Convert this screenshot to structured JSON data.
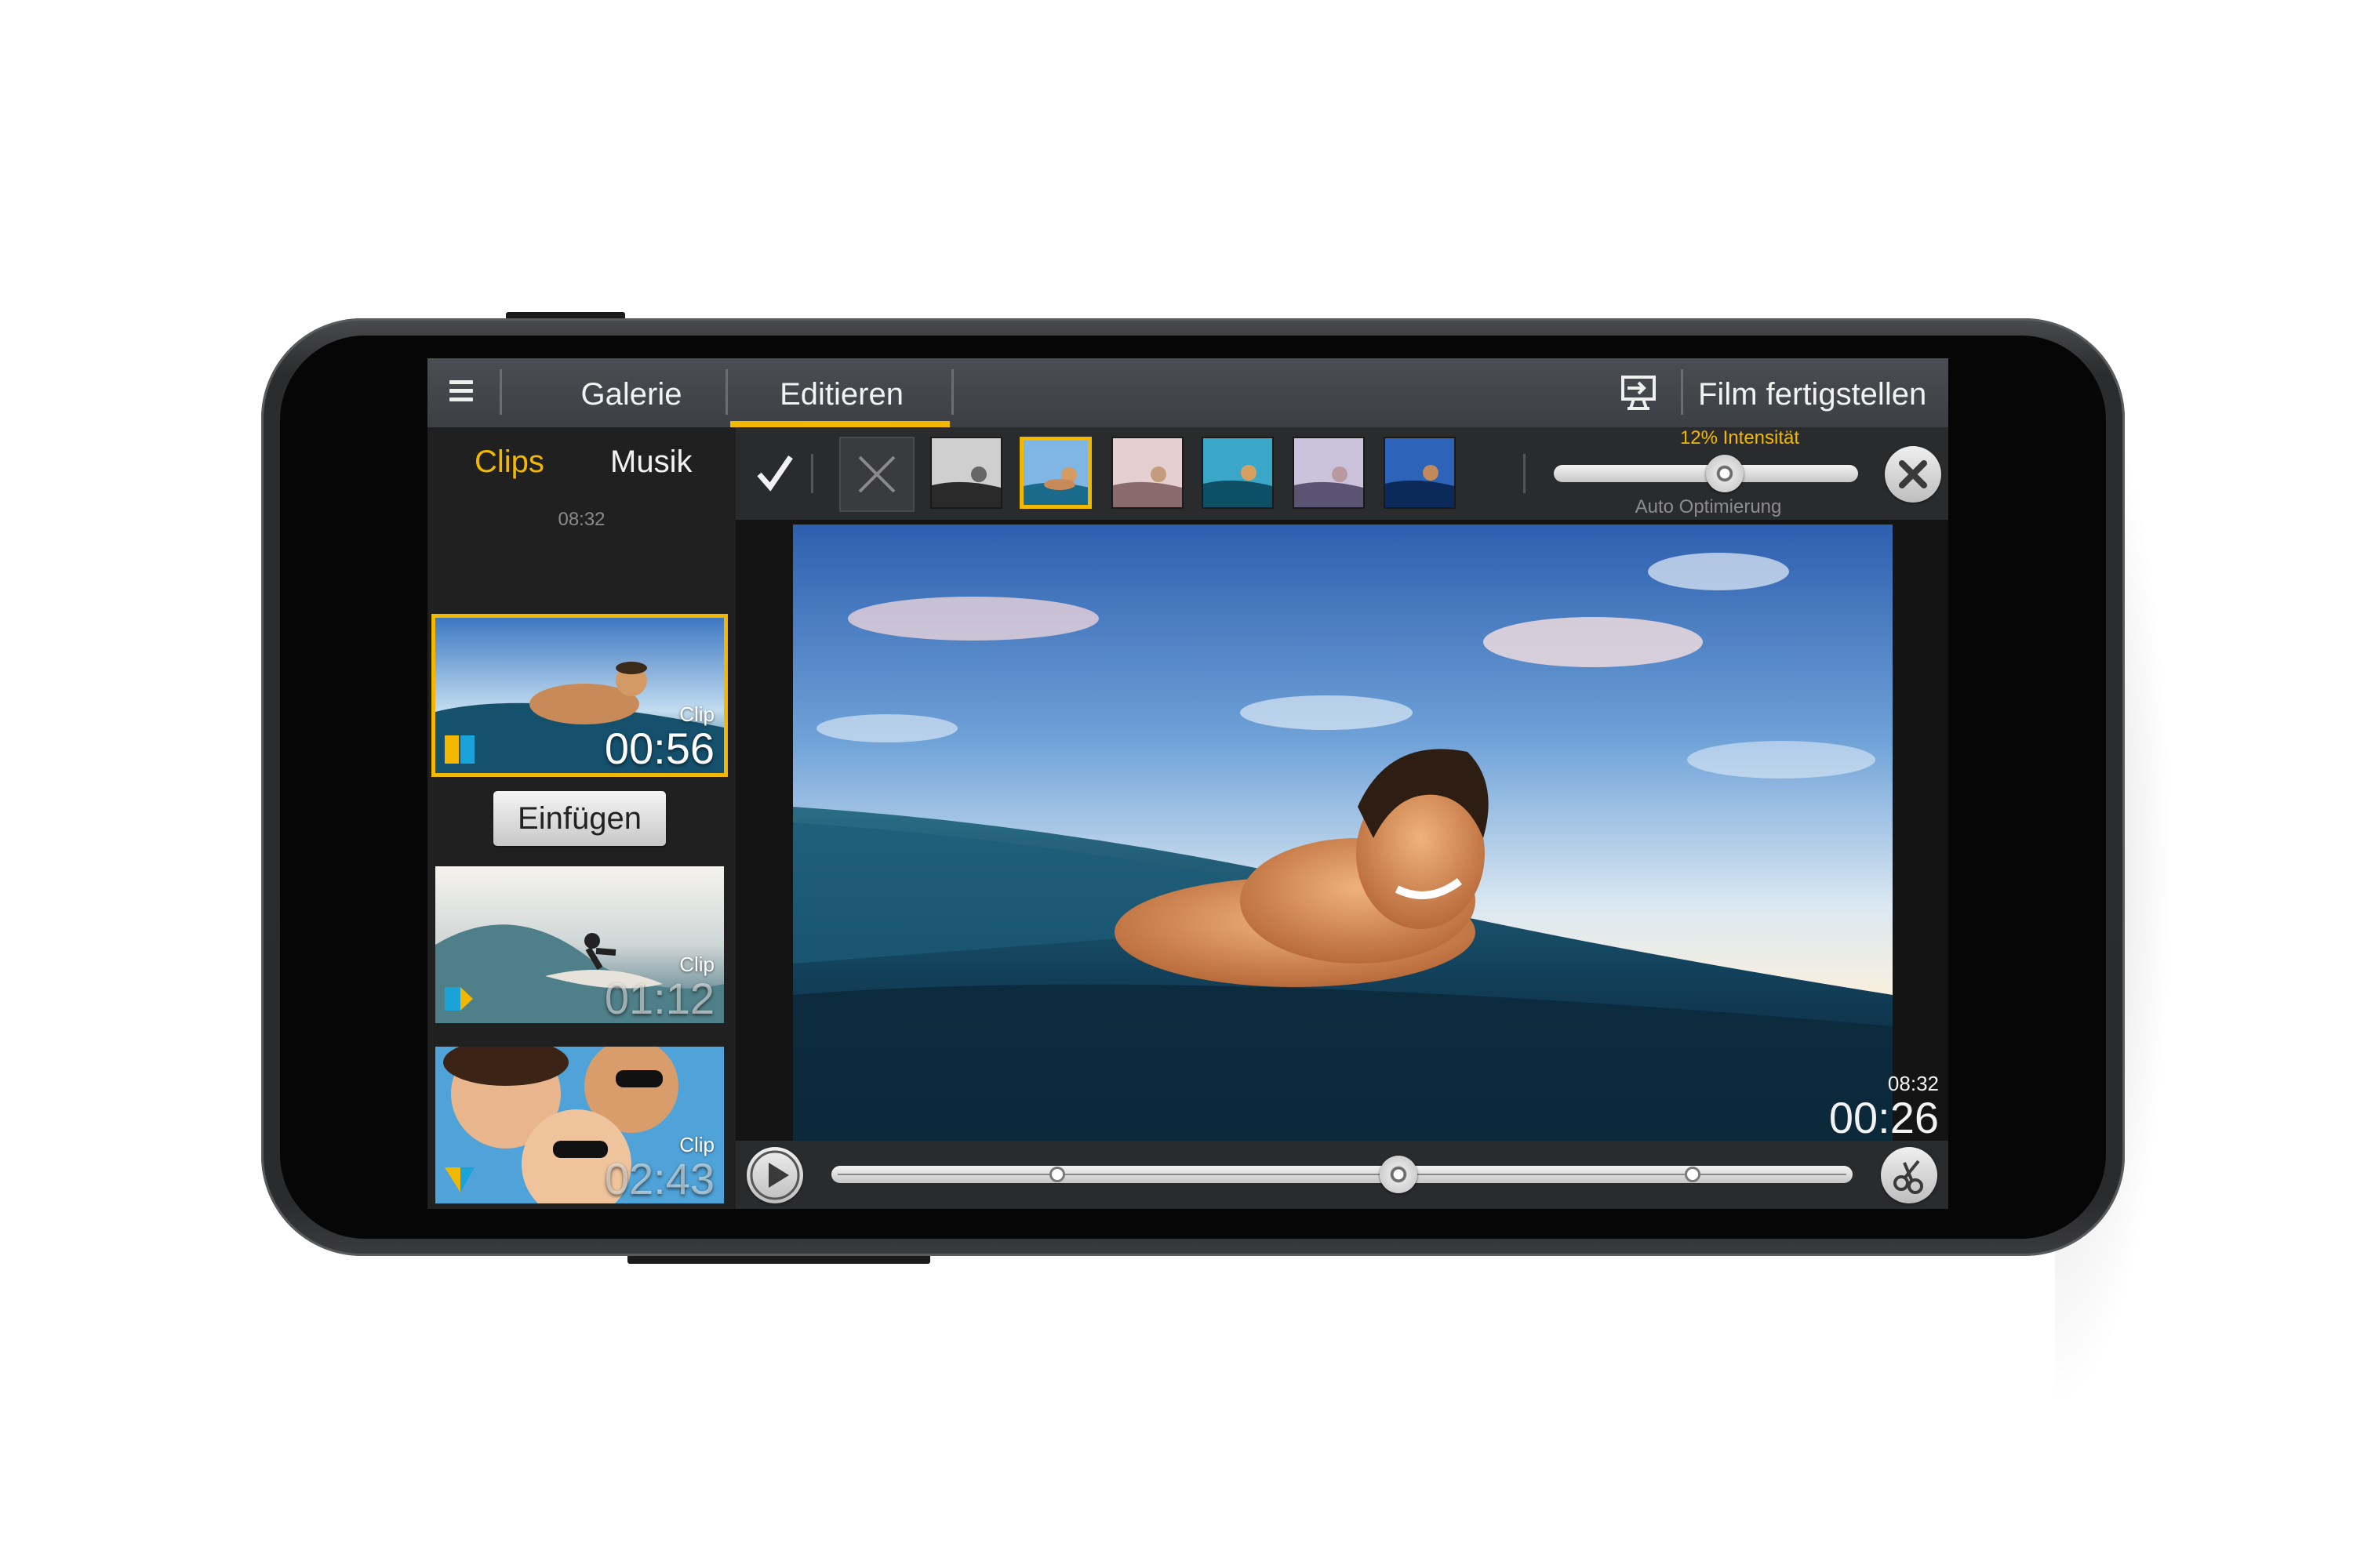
{
  "topbar": {
    "menu_icon": "hamburger-menu-icon",
    "tabs": [
      {
        "label": "Galerie",
        "active": false
      },
      {
        "label": "Editieren",
        "active": true
      }
    ],
    "export_icon": "export-screen-icon",
    "finish_label": "Film fertigstellen"
  },
  "sidebar": {
    "tabs": [
      {
        "label": "Clips",
        "active": true
      },
      {
        "label": "Musik",
        "active": false
      }
    ],
    "total_time": "08:32",
    "insert_label": "Einfügen",
    "clips": [
      {
        "caption": "Clip",
        "duration": "00:56",
        "selected": true
      },
      {
        "caption": "Clip",
        "duration": "01:12",
        "selected": false
      },
      {
        "caption": "Clip",
        "duration": "02:43",
        "selected": false
      },
      {
        "caption": "",
        "duration": "",
        "selected": false
      }
    ]
  },
  "edit_toolbar": {
    "confirm_icon": "checkmark-icon",
    "discard_icon": "cross-icon",
    "filters": [
      {
        "name": "black-white",
        "selected": false
      },
      {
        "name": "original",
        "selected": true
      },
      {
        "name": "warm-fade",
        "selected": false
      },
      {
        "name": "cool",
        "selected": false
      },
      {
        "name": "lavender",
        "selected": false
      },
      {
        "name": "deep-blue",
        "selected": false
      }
    ],
    "intensity_label": "12% Intensität",
    "intensity_value": 0.6,
    "auto_label": "Auto Optimierung",
    "close_icon": "close-circle-icon"
  },
  "preview": {
    "total_time": "08:32",
    "current_time": "00:26"
  },
  "timeline": {
    "play_icon": "play-icon",
    "markers": [
      0.21,
      0.83
    ],
    "playhead": 0.555,
    "cut_icon": "scissors-icon"
  },
  "colors": {
    "accent": "#f2b800",
    "bar": "#3c3f44",
    "panel": "#202020"
  }
}
